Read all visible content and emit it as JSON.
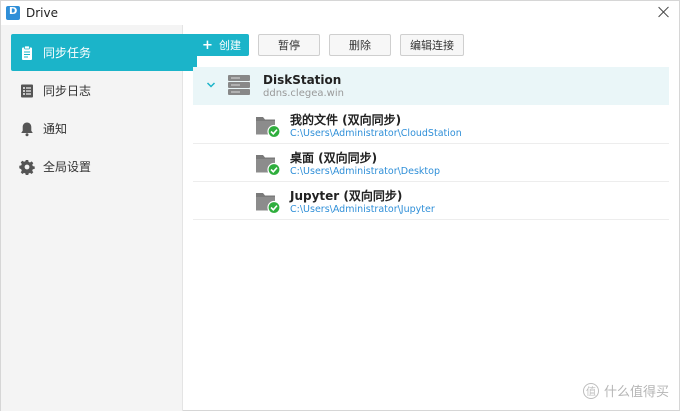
{
  "window": {
    "title": "Drive"
  },
  "sidebar": {
    "items": [
      {
        "label": "同步任务",
        "icon": "clipboard-icon",
        "active": true
      },
      {
        "label": "同步日志",
        "icon": "list-icon",
        "active": false
      },
      {
        "label": "通知",
        "icon": "bell-icon",
        "active": false
      },
      {
        "label": "全局设置",
        "icon": "gear-icon",
        "active": false
      }
    ]
  },
  "toolbar": {
    "create_label": "创建",
    "pause_label": "暂停",
    "delete_label": "删除",
    "edit_connection_label": "编辑连接"
  },
  "server": {
    "name": "DiskStation",
    "host": "ddns.clegea.win"
  },
  "tasks": [
    {
      "name": "我的文件 (双向同步)",
      "path": "C:\\Users\\Administrator\\CloudStation"
    },
    {
      "name": "桌面 (双向同步)",
      "path": "C:\\Users\\Administrator\\Desktop"
    },
    {
      "name": "Jupyter (双向同步)",
      "path": "C:\\Users\\Administrator\\Jupyter"
    }
  ],
  "watermark": {
    "text": "什么值得买",
    "badge": "值"
  },
  "colors": {
    "accent": "#1bb4c9",
    "path_link": "#2f8fd8",
    "check_green": "#2fae3d"
  }
}
